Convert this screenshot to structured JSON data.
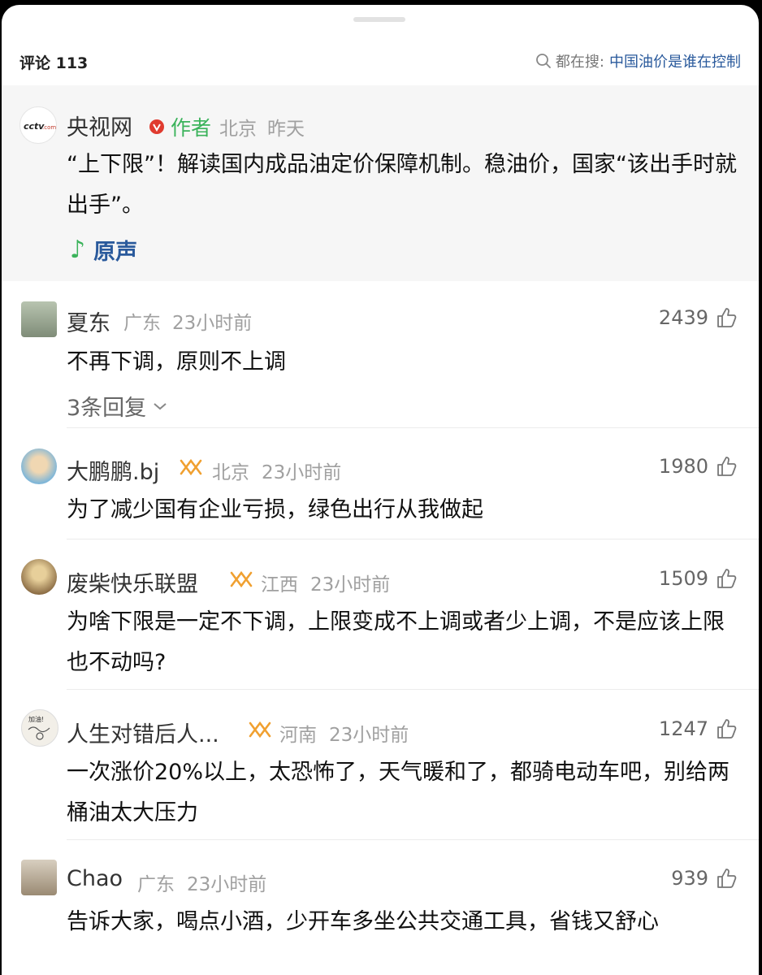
{
  "header": {
    "comments_label": "评论 113",
    "trending_label": "都在搜:",
    "trending_query": "中国油价是谁在控制"
  },
  "author_post": {
    "name": "央视网",
    "badge": "作者",
    "location": "北京",
    "time": "昨天",
    "text": "“上下限”！解读国内成品油定价保障机制。稳油价，国家“该出手时就出手”。",
    "voice_label": "原声",
    "accent_color": "#3bb35b",
    "verified_color": "#e03b2f"
  },
  "comments": [
    {
      "name": "夏东",
      "location": "广东",
      "time": "23小时前",
      "likes": "2439",
      "text": "不再下调，原则不上调",
      "replies": "3条回复"
    },
    {
      "name": "大鹏鹏.bj",
      "location": "北京",
      "time": "23小时前",
      "likes": "1980",
      "text": "为了减少国有企业亏损，绿色出行从我做起"
    },
    {
      "name": "废柴快乐联盟",
      "location": "江西",
      "time": "23小时前",
      "likes": "1509",
      "text": "为啥下限是一定不下调，上限变成不上调或者少上调，不是应该上限也不动吗?"
    },
    {
      "name": "人生对错后人...",
      "location": "河南",
      "time": "23小时前",
      "likes": "1247",
      "text": "一次涨价20%以上，太恐怖了，天气暖和了，都骑电动车吧，别给两桶油太大压力"
    },
    {
      "name": "Chao",
      "location": "广东",
      "time": "23小时前",
      "likes": "939",
      "text": "告诉大家，喝点小酒，少开车多坐公共交通工具，省钱又舒心"
    }
  ],
  "colors": {
    "vip_badge": "#f0a030",
    "link": "#2a5a9c"
  }
}
